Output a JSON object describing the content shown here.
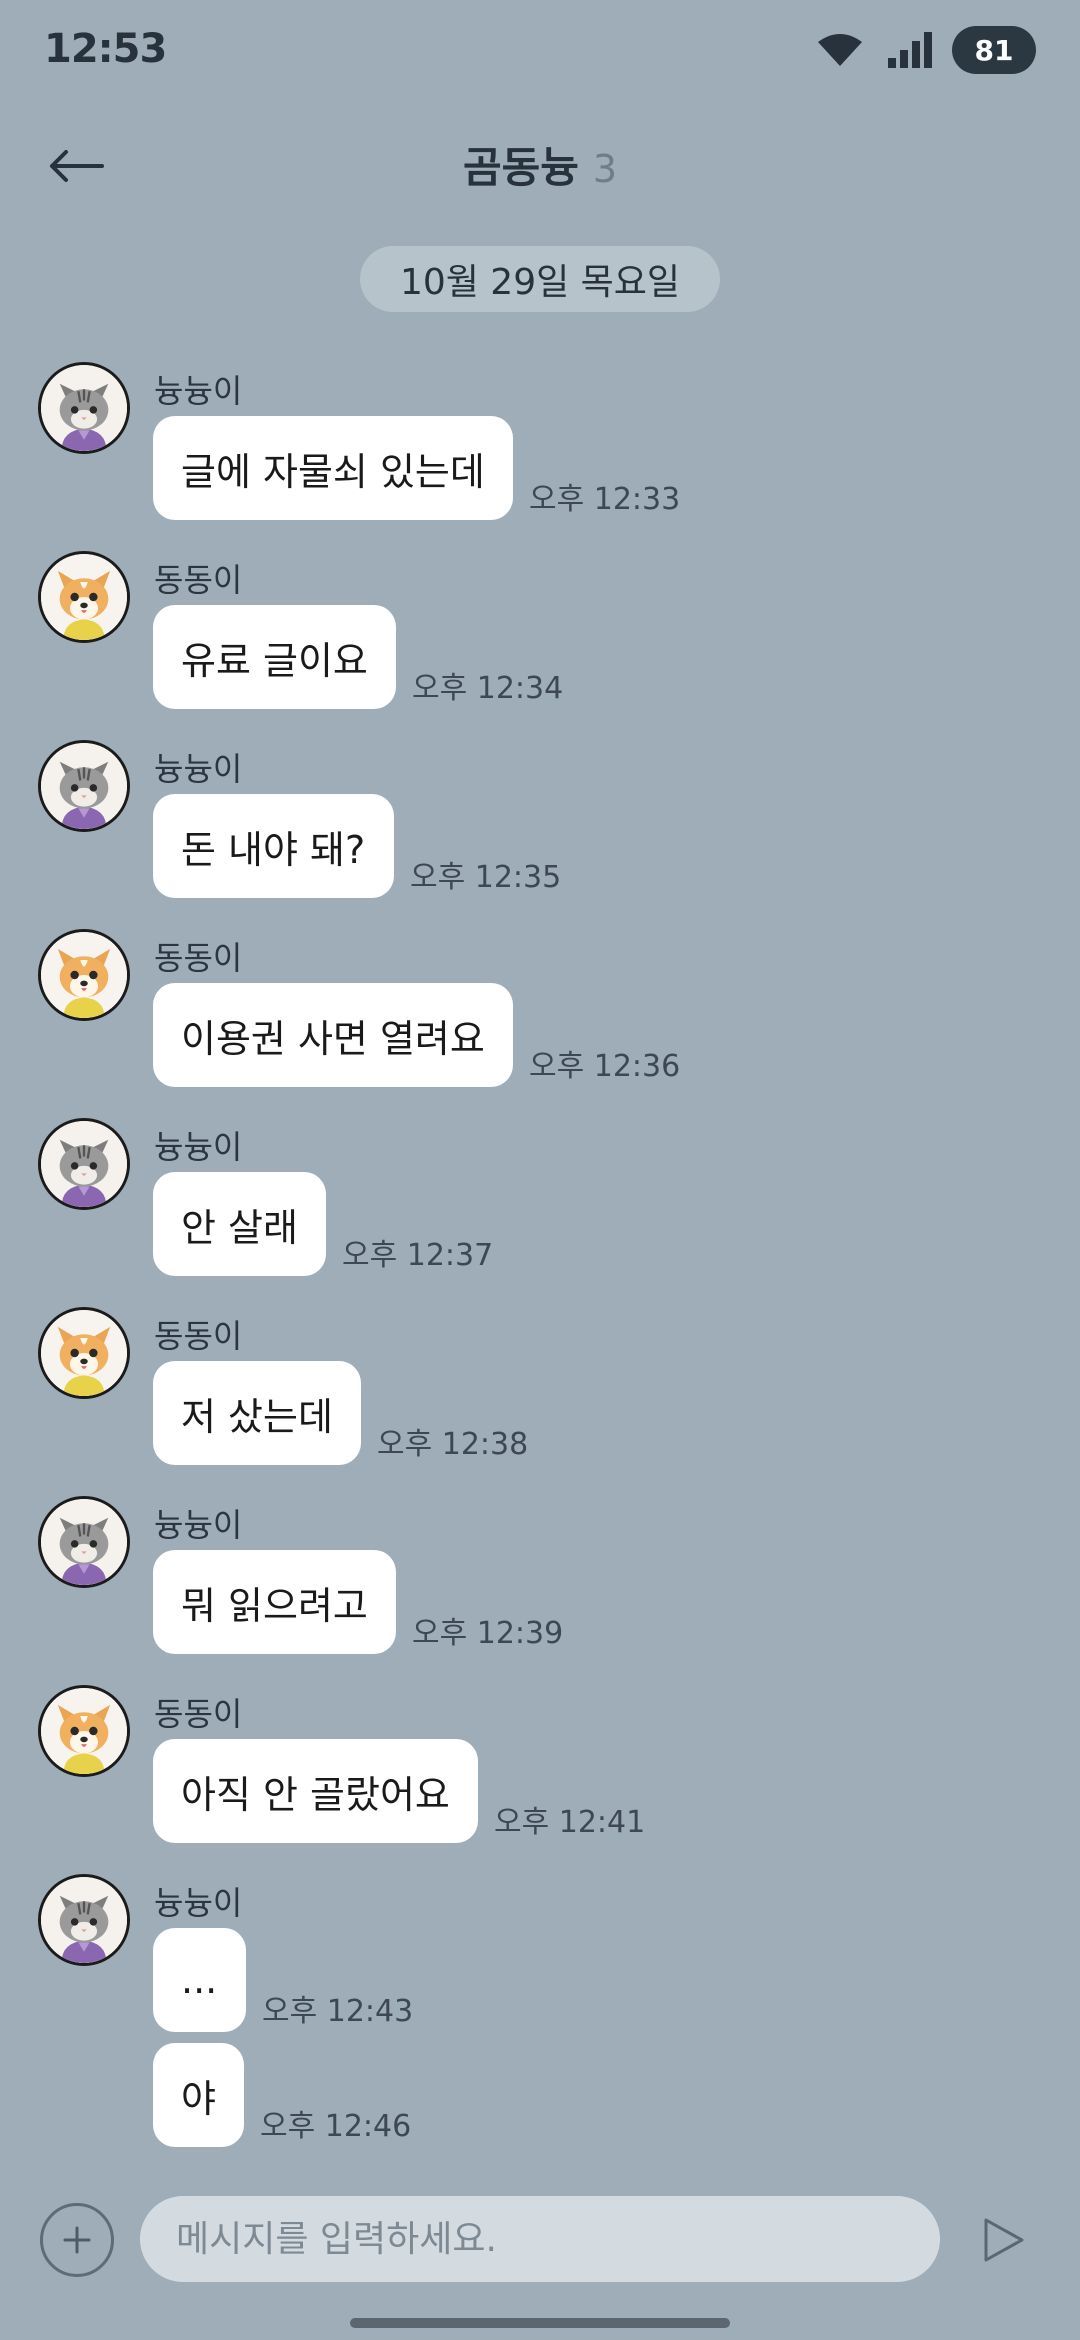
{
  "status": {
    "time": "12:53",
    "battery": "81"
  },
  "header": {
    "title": "곰동늉",
    "member_count": "3"
  },
  "date_divider": "10월 29일 목요일",
  "messages": [
    {
      "sender": "늉늉이",
      "avatar": "cat-avatar",
      "bubbles": [
        {
          "text": "글에 자물쇠 있는데",
          "time": "오후 12:33"
        }
      ]
    },
    {
      "sender": "동동이",
      "avatar": "dog-avatar",
      "bubbles": [
        {
          "text": "유료 글이요",
          "time": "오후 12:34"
        }
      ]
    },
    {
      "sender": "늉늉이",
      "avatar": "cat-avatar",
      "bubbles": [
        {
          "text": "돈 내야 돼?",
          "time": "오후 12:35"
        }
      ]
    },
    {
      "sender": "동동이",
      "avatar": "dog-avatar",
      "bubbles": [
        {
          "text": "이용권 사면 열려요",
          "time": "오후 12:36"
        }
      ]
    },
    {
      "sender": "늉늉이",
      "avatar": "cat-avatar",
      "bubbles": [
        {
          "text": "안 살래",
          "time": "오후 12:37"
        }
      ]
    },
    {
      "sender": "동동이",
      "avatar": "dog-avatar",
      "bubbles": [
        {
          "text": "저 샀는데",
          "time": "오후 12:38"
        }
      ]
    },
    {
      "sender": "늉늉이",
      "avatar": "cat-avatar",
      "bubbles": [
        {
          "text": "뭐 읽으려고",
          "time": "오후 12:39"
        }
      ]
    },
    {
      "sender": "동동이",
      "avatar": "dog-avatar",
      "bubbles": [
        {
          "text": "아직 안 골랐어요",
          "time": "오후 12:41"
        }
      ]
    },
    {
      "sender": "늉늉이",
      "avatar": "cat-avatar",
      "bubbles": [
        {
          "text": "...",
          "time": "오후 12:43"
        },
        {
          "text": "야",
          "time": "오후 12:46"
        }
      ]
    }
  ],
  "composer": {
    "placeholder": "메시지를 입력하세요.",
    "plus_icon": "plus-icon",
    "send_icon": "send-icon"
  },
  "colors": {
    "background": "#9eadb8",
    "bubble": "#ffffff",
    "date_chip": "#b7c3cb",
    "input": "#d3dbe1"
  }
}
